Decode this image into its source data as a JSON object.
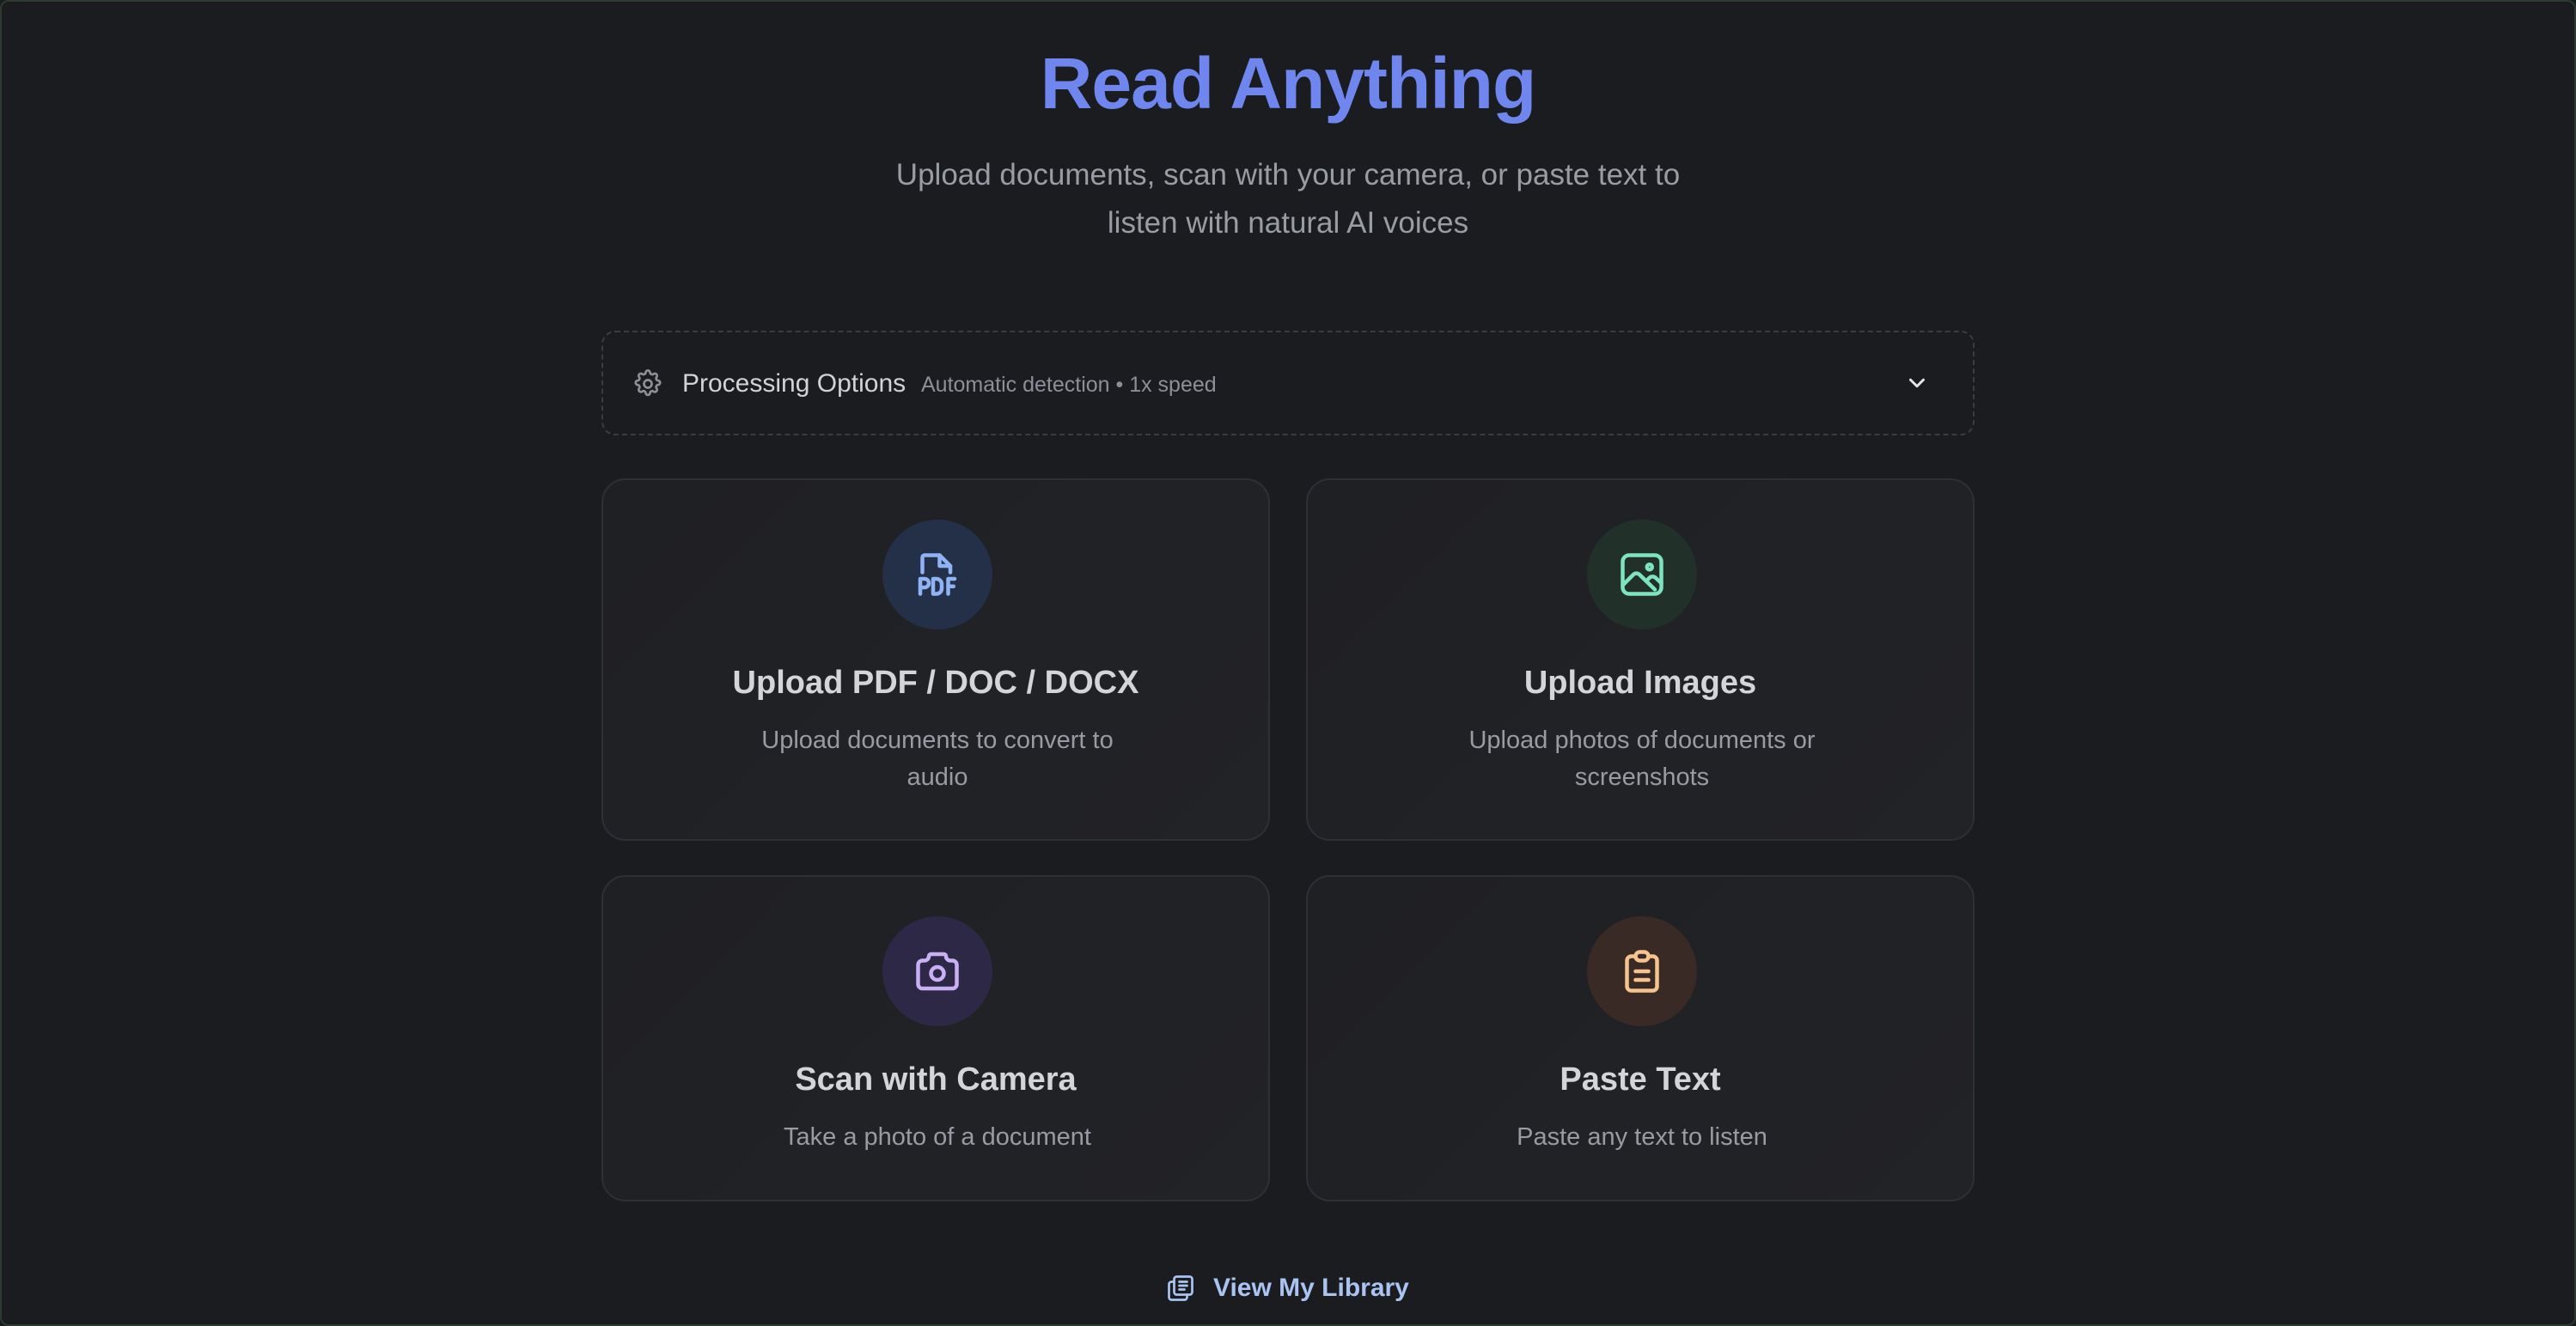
{
  "header": {
    "title": "Read Anything",
    "subtitle": "Upload documents, scan with your camera, or paste text to listen with natural AI voices"
  },
  "processing_options": {
    "label": "Processing Options",
    "summary": "Automatic detection • 1x speed",
    "icon": "gear-icon",
    "toggle_icon": "chevron-down-icon"
  },
  "cards": [
    {
      "title": "Upload PDF / DOC / DOCX",
      "description": "Upload documents to convert to audio",
      "icon": "pdf-file-icon",
      "icon_bg": "#243048",
      "icon_color": "#8fb3f5"
    },
    {
      "title": "Upload Images",
      "description": "Upload photos of documents or screenshots",
      "icon": "image-icon",
      "icon_bg": "#213029",
      "icon_color": "#7ee3c0"
    },
    {
      "title": "Scan with Camera",
      "description": "Take a photo of a document",
      "icon": "camera-icon",
      "icon_bg": "#2d2846",
      "icon_color": "#c9b0f5"
    },
    {
      "title": "Paste Text",
      "description": "Paste any text to listen",
      "icon": "clipboard-icon",
      "icon_bg": "#3a2a26",
      "icon_color": "#f5c48e"
    }
  ],
  "library": {
    "label": "View My Library",
    "icon": "library-icon"
  },
  "colors": {
    "background": "#1b1c20",
    "accent": "#6e86ee",
    "link": "#a9c4f0"
  }
}
